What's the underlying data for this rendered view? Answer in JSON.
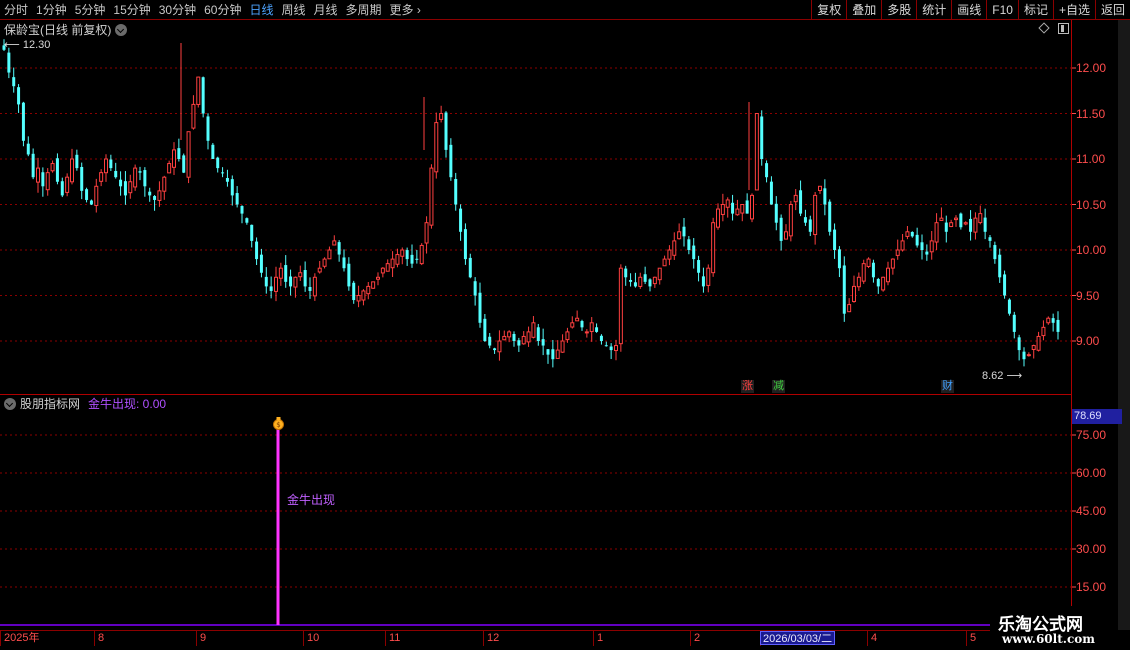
{
  "toolbar": {
    "periods": [
      "分时",
      "1分钟",
      "5分钟",
      "15分钟",
      "30分钟",
      "60分钟",
      "日线",
      "周线",
      "月线",
      "多周期",
      "更多"
    ],
    "active_period": "日线",
    "buttons": [
      "复权",
      "叠加",
      "多股",
      "统计",
      "画线",
      "F10",
      "标记",
      "+自选",
      "返回"
    ]
  },
  "main": {
    "title": "保龄宝(日线 前复权)",
    "price_axis": [
      "12.00",
      "11.50",
      "11.00",
      "10.50",
      "10.00",
      "9.50",
      "9.00"
    ],
    "high_label": "12.30",
    "low_label": "8.62",
    "badges": [
      {
        "text": "涨",
        "color": "#ff4040"
      },
      {
        "text": "减",
        "color": "#40d040"
      },
      {
        "text": "财",
        "color": "#40a0ff"
      }
    ]
  },
  "indicator": {
    "title": "股朋指标网",
    "field": "金牛出现: 0.00",
    "signal_text": "金牛出现",
    "current_value": "78.69",
    "axis": [
      "75.00",
      "60.00",
      "45.00",
      "30.00",
      "15.00"
    ]
  },
  "date_axis": {
    "ticks": [
      "2025年",
      "8",
      "9",
      "10",
      "11",
      "12",
      "1",
      "2",
      "3",
      "4",
      "5"
    ],
    "cursor": "2026/03/03/二"
  },
  "watermark": {
    "line1": "乐淘公式网",
    "line2": "www.60lt.com"
  },
  "colors": {
    "up": "#ff4040",
    "down": "#54ffff",
    "grid": "#8b0000",
    "axis_text": "#ff4d4d",
    "signal": "#ff33ff"
  },
  "chart_data": {
    "type": "candlestick",
    "y_range": [
      8.62,
      12.3
    ],
    "closes": [
      12.2,
      11.95,
      11.8,
      11.6,
      11.2,
      11.05,
      10.8,
      10.9,
      10.7,
      10.85,
      10.95,
      10.75,
      10.6,
      10.8,
      11.0,
      10.9,
      10.65,
      10.55,
      10.5,
      10.7,
      10.85,
      11.0,
      10.9,
      10.8,
      10.7,
      10.6,
      10.75,
      10.9,
      10.85,
      10.7,
      10.6,
      10.55,
      10.65,
      10.8,
      10.95,
      11.1,
      11.0,
      10.85,
      11.3,
      11.6,
      11.9,
      11.5,
      11.2,
      11.0,
      10.9,
      10.85,
      10.75,
      10.6,
      10.5,
      10.4,
      10.3,
      10.1,
      9.9,
      9.75,
      9.6,
      9.55,
      9.7,
      9.8,
      9.65,
      9.6,
      9.7,
      9.75,
      9.6,
      9.55,
      9.7,
      9.8,
      9.9,
      10.0,
      10.1,
      9.95,
      9.8,
      9.6,
      9.45,
      9.5,
      9.55,
      9.6,
      9.65,
      9.7,
      9.8,
      9.85,
      9.9,
      9.95,
      10.0,
      9.9,
      9.85,
      9.9,
      10.05,
      10.3,
      10.9,
      11.4,
      11.5,
      11.1,
      10.8,
      10.5,
      10.2,
      9.9,
      9.7,
      9.5,
      9.2,
      9.0,
      8.95,
      8.9,
      9.0,
      9.05,
      9.1,
      9.0,
      8.95,
      9.05,
      9.1,
      9.2,
      9.0,
      8.95,
      8.85,
      8.8,
      8.9,
      9.0,
      9.1,
      9.2,
      9.25,
      9.15,
      9.1,
      9.2,
      9.1,
      9.0,
      8.95,
      8.9,
      8.95,
      9.8,
      9.7,
      9.65,
      9.6,
      9.7,
      9.65,
      9.6,
      9.7,
      9.8,
      9.9,
      10.0,
      10.1,
      10.2,
      10.15,
      10.0,
      9.9,
      9.75,
      9.6,
      9.8,
      10.3,
      10.45,
      10.5,
      10.55,
      10.4,
      10.45,
      10.5,
      10.4,
      10.6,
      11.5,
      11.0,
      10.8,
      10.5,
      10.3,
      10.1,
      10.2,
      10.5,
      10.6,
      10.4,
      10.3,
      10.2,
      10.6,
      10.7,
      10.5,
      10.2,
      10.0,
      9.8,
      9.3,
      9.4,
      9.6,
      9.7,
      9.85,
      9.9,
      9.7,
      9.6,
      9.7,
      9.8,
      9.9,
      10.0,
      10.1,
      10.2,
      10.15,
      10.05,
      10.0,
      9.95,
      10.1,
      10.3,
      10.35,
      10.2,
      10.3,
      10.35,
      10.25,
      10.3,
      10.2,
      10.35,
      10.4,
      10.2,
      10.1,
      9.9,
      9.7,
      9.5,
      9.3,
      9.1,
      8.9,
      8.8,
      8.85,
      8.95,
      9.05,
      9.15,
      9.25,
      9.2,
      9.1
    ]
  }
}
